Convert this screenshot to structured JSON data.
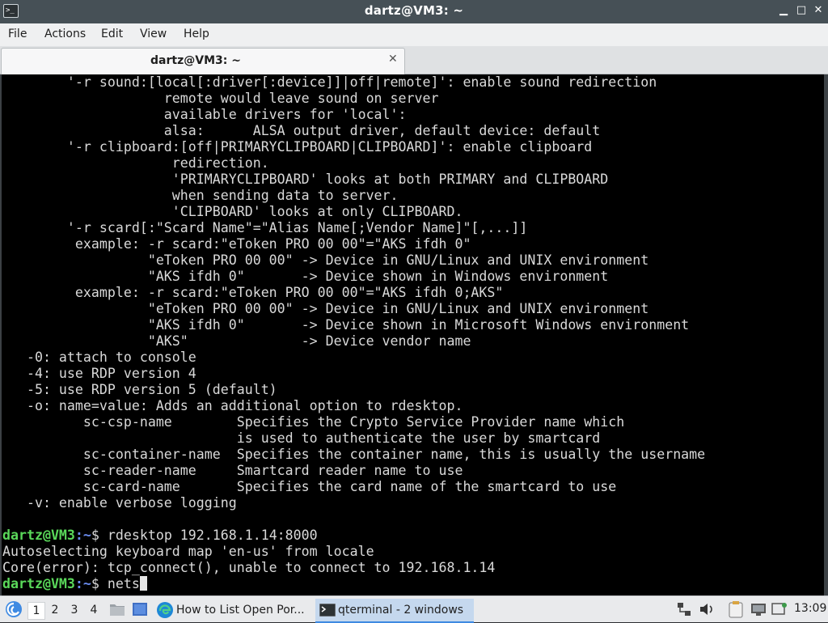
{
  "window": {
    "title": "dartz@VM3: ~",
    "icon_glyph": ">_"
  },
  "controls": {
    "minimize": "▁",
    "maximize": "□",
    "close": "✕"
  },
  "menu": [
    "File",
    "Actions",
    "Edit",
    "View",
    "Help"
  ],
  "tab": {
    "label": "dartz@VM3: ~",
    "close": "✕"
  },
  "terminal": {
    "lines": [
      {
        "text": "        '-r sound:[local[:driver[:device]]|off|remote]': enable sound redirection"
      },
      {
        "text": "                    remote would leave sound on server"
      },
      {
        "text": "                    available drivers for 'local':"
      },
      {
        "text": "                    alsa:      ALSA output driver, default device: default"
      },
      {
        "text": "        '-r clipboard:[off|PRIMARYCLIPBOARD|CLIPBOARD]': enable clipboard"
      },
      {
        "text": "                     redirection."
      },
      {
        "text": "                     'PRIMARYCLIPBOARD' looks at both PRIMARY and CLIPBOARD"
      },
      {
        "text": "                     when sending data to server."
      },
      {
        "text": "                     'CLIPBOARD' looks at only CLIPBOARD."
      },
      {
        "text": "        '-r scard[:\"Scard Name\"=\"Alias Name[;Vendor Name]\"[,...]]"
      },
      {
        "text": "         example: -r scard:\"eToken PRO 00 00\"=\"AKS ifdh 0\""
      },
      {
        "text": "                  \"eToken PRO 00 00\" -> Device in GNU/Linux and UNIX environment"
      },
      {
        "text": "                  \"AKS ifdh 0\"       -> Device shown in Windows environment"
      },
      {
        "text": "         example: -r scard:\"eToken PRO 00 00\"=\"AKS ifdh 0;AKS\""
      },
      {
        "text": "                  \"eToken PRO 00 00\" -> Device in GNU/Linux and UNIX environment"
      },
      {
        "text": "                  \"AKS ifdh 0\"       -> Device shown in Microsoft Windows environment"
      },
      {
        "text": "                  \"AKS\"              -> Device vendor name"
      },
      {
        "text": "   -0: attach to console"
      },
      {
        "text": "   -4: use RDP version 4"
      },
      {
        "text": "   -5: use RDP version 5 (default)"
      },
      {
        "text": "   -o: name=value: Adds an additional option to rdesktop."
      },
      {
        "text": "          sc-csp-name        Specifies the Crypto Service Provider name which"
      },
      {
        "text": "                             is used to authenticate the user by smartcard"
      },
      {
        "text": "          sc-container-name  Specifies the container name, this is usually the username"
      },
      {
        "text": "          sc-reader-name     Smartcard reader name to use"
      },
      {
        "text": "          sc-card-name       Specifies the card name of the smartcard to use"
      },
      {
        "text": "   -v: enable verbose logging"
      },
      {
        "text": ""
      },
      {
        "prompt": true,
        "user": "dartz@VM3",
        "path": ":~",
        "cmd": "$ rdesktop 192.168.1.14:8000"
      },
      {
        "text": "Autoselecting keyboard map 'en-us' from locale"
      },
      {
        "text": "Core(error): tcp_connect(), unable to connect to 192.168.1.14"
      },
      {
        "prompt": true,
        "user": "dartz@VM3",
        "path": ":~",
        "cmd": "$ nets",
        "cursor": true
      }
    ]
  },
  "taskbar": {
    "workspaces": [
      "1",
      "2",
      "3",
      "4"
    ],
    "active_workspace": "1",
    "tasks": [
      {
        "label": "How to List Open Por...",
        "icon": "edge-browser-icon"
      },
      {
        "label": "qterminal - 2 windows",
        "icon": "terminal-icon",
        "active": true
      }
    ],
    "clock": "13:09"
  },
  "colors": {
    "titlebar": "#465056",
    "prompt_user": "#5ad85a",
    "prompt_path": "#6a8cf0",
    "terminal_bg": "#000000",
    "terminal_fg": "#d9d9d9"
  }
}
